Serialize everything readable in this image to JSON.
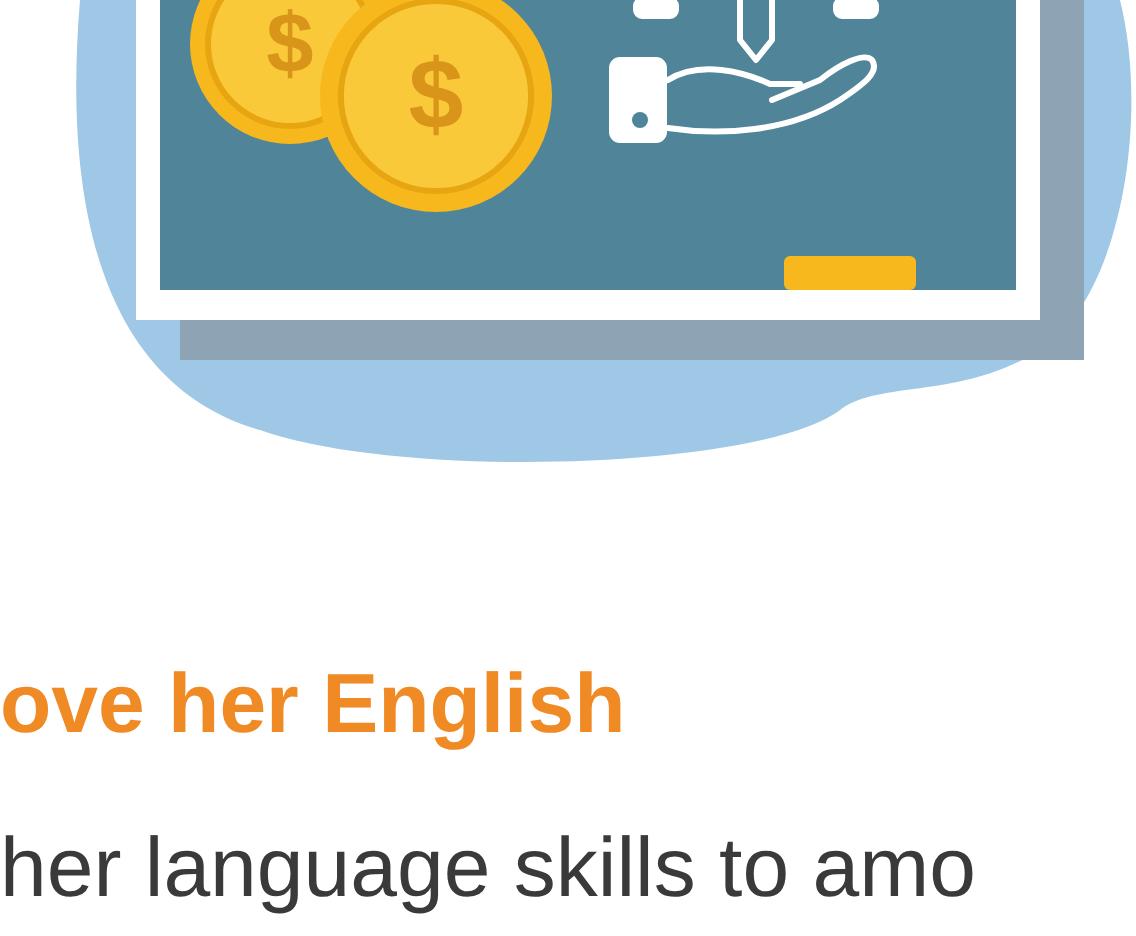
{
  "illustration": {
    "coin_symbol": "$"
  },
  "heading": "ove her English",
  "body_text": "her language skills to amo"
}
